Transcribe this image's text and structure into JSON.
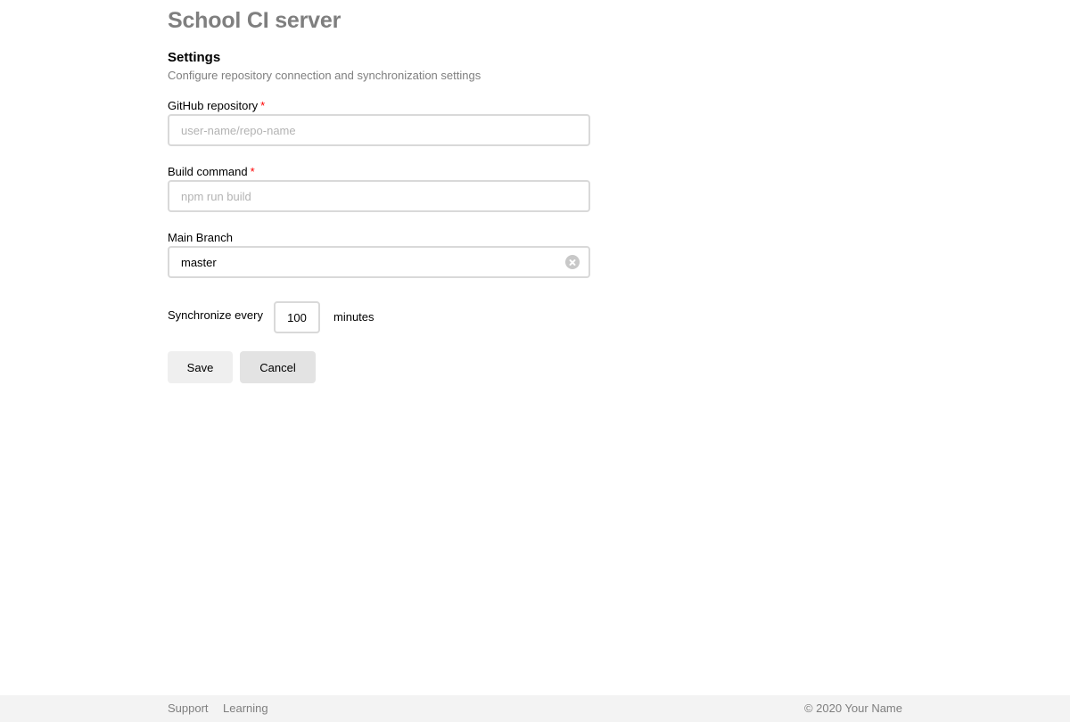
{
  "header": {
    "title": "School CI server"
  },
  "settings": {
    "title": "Settings",
    "subtitle": "Configure repository connection and synchronization settings",
    "required_mark": "*",
    "repository": {
      "label": "GitHub repository",
      "placeholder": "user-name/repo-name",
      "value": ""
    },
    "build_command": {
      "label": "Build command",
      "placeholder": "npm run build",
      "value": ""
    },
    "main_branch": {
      "label": "Main Branch",
      "value": "master",
      "clear_icon": "clear-icon"
    },
    "sync": {
      "label": "Synchronize every",
      "value": "100",
      "unit": "minutes"
    }
  },
  "actions": {
    "save_label": "Save",
    "cancel_label": "Cancel"
  },
  "footer": {
    "links": [
      {
        "label": "Support"
      },
      {
        "label": "Learning"
      }
    ],
    "copyright": "© 2020 Your Name"
  }
}
